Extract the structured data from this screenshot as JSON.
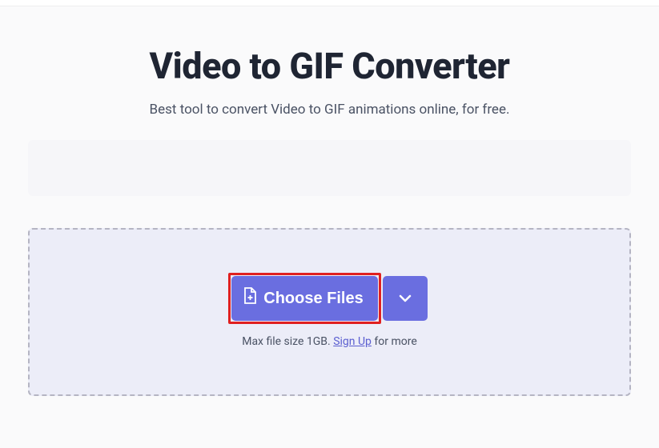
{
  "header": {
    "title": "Video to GIF Converter",
    "subtitle": "Best tool to convert Video to GIF animations online, for free."
  },
  "dropzone": {
    "choose_label": "Choose Files",
    "hint_prefix": "Max file size 1GB. ",
    "signup_label": "Sign Up",
    "hint_suffix": " for more"
  },
  "colors": {
    "accent": "#6a6ee0",
    "highlight": "#e02020"
  }
}
